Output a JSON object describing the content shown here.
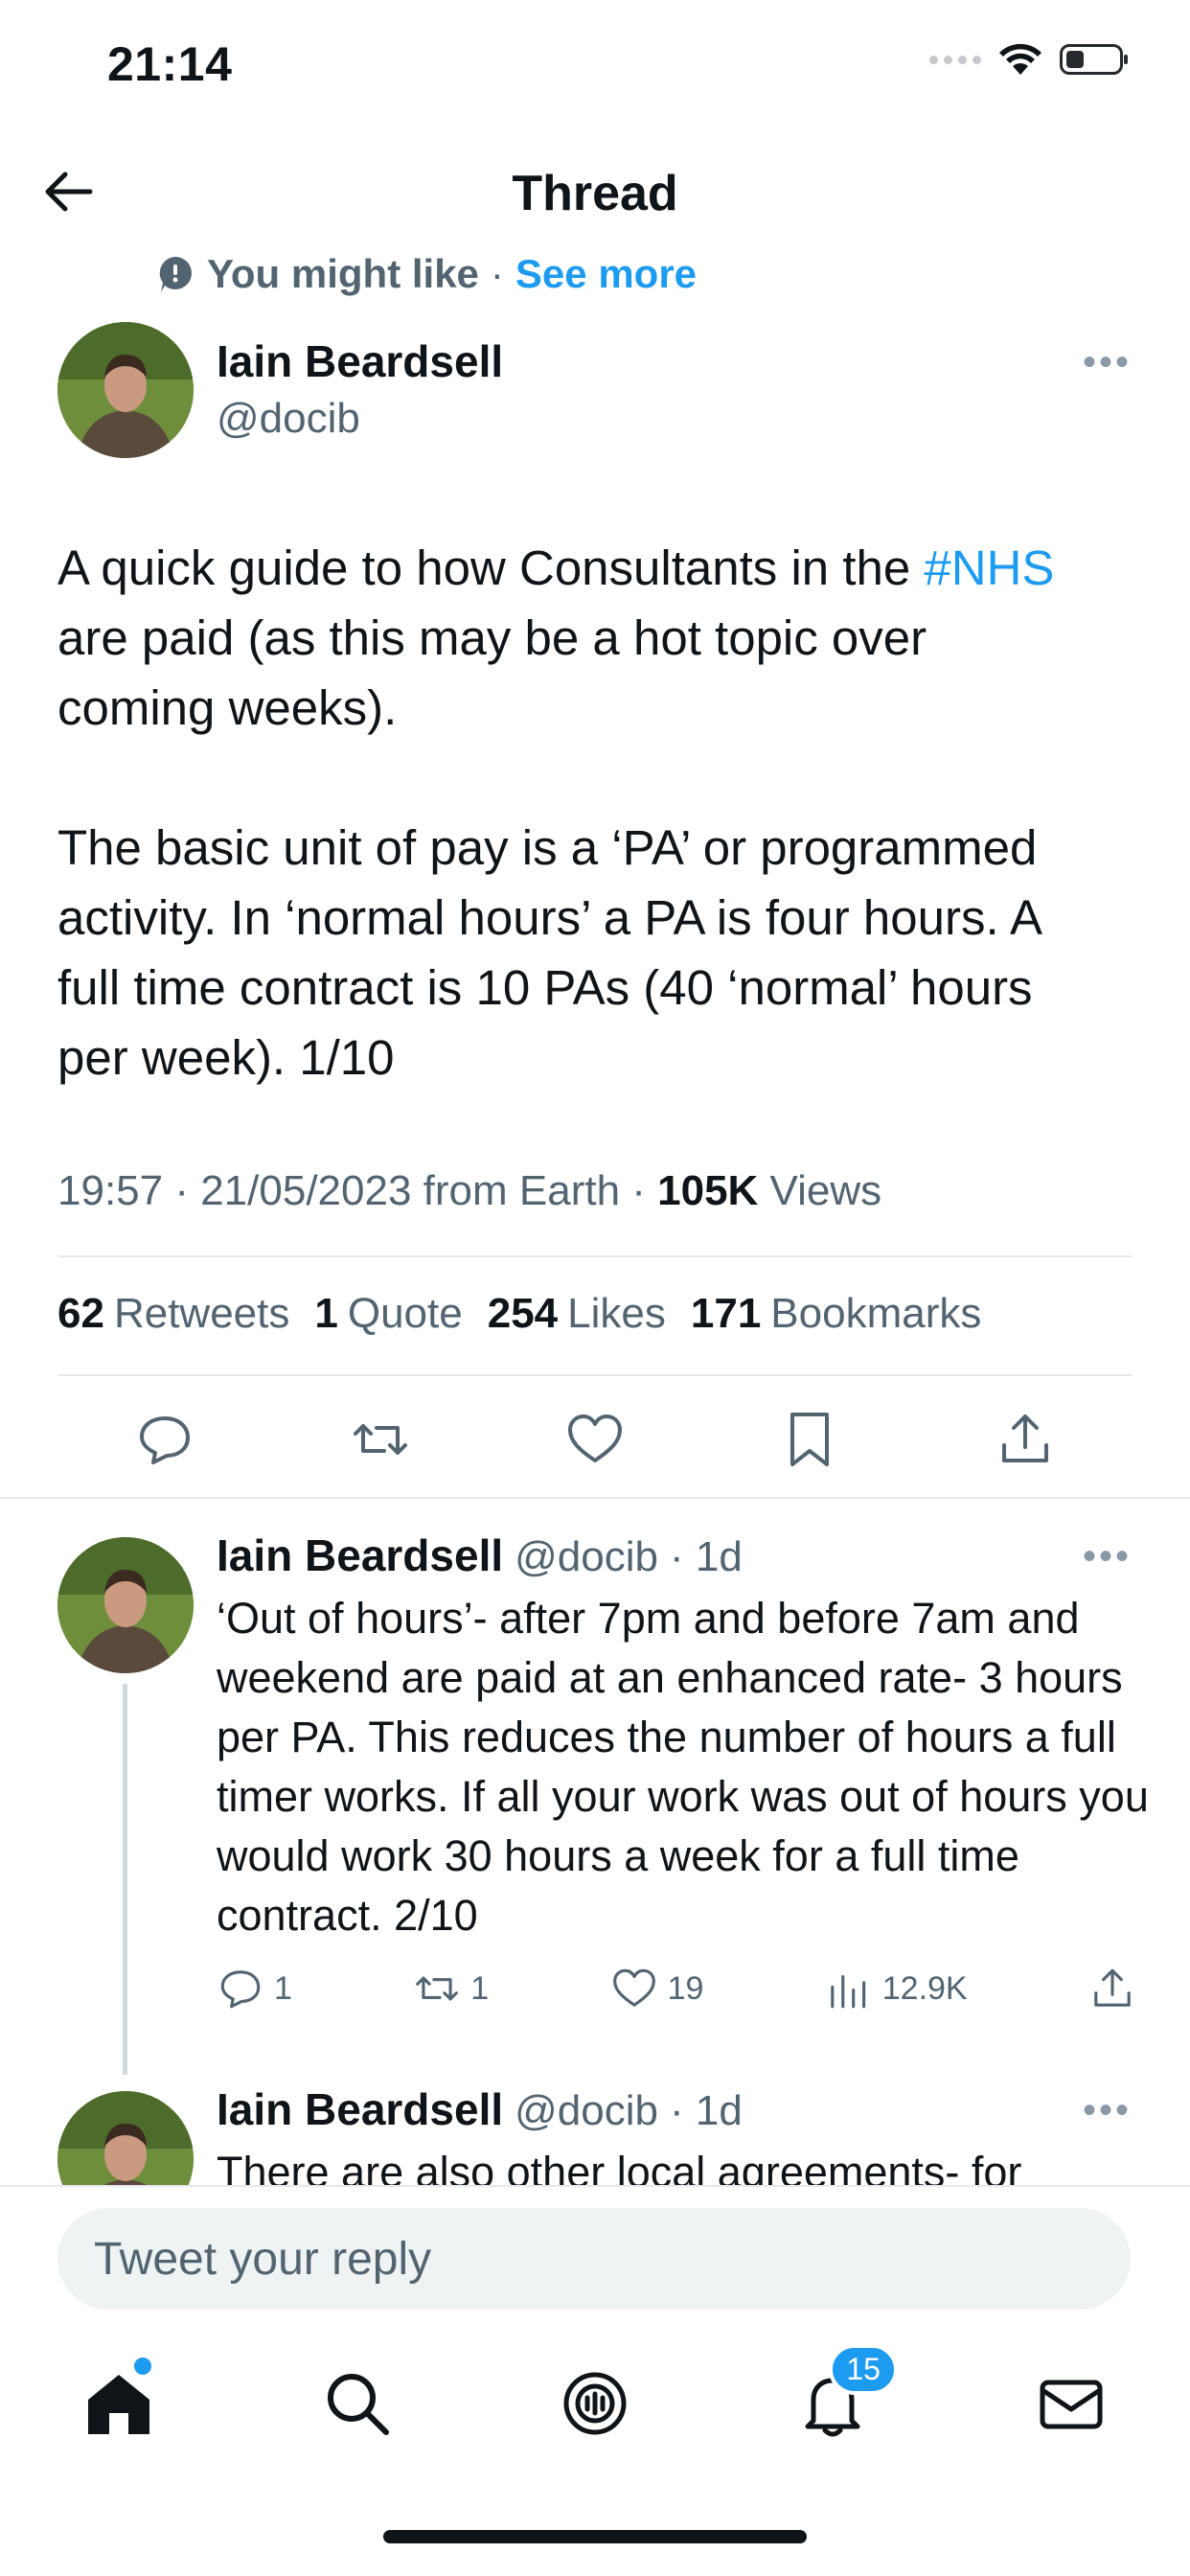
{
  "status_bar": {
    "time": "21:14"
  },
  "header": {
    "title": "Thread"
  },
  "suggestion": {
    "label": "You might like",
    "separator": "·",
    "link": "See more"
  },
  "main_tweet": {
    "name": "Iain Beardsell",
    "handle": "@docib",
    "text_before_tag": "A quick guide to how Consultants in the ",
    "hashtag": "#NHS",
    "text_after_tag": "\nare paid (as this may be a hot topic over\ncoming weeks).\n\nThe basic unit of pay is a ‘PA’ or programmed\nactivity. In ‘normal hours’ a PA is four hours. A\nfull time contract is 10 PAs (40 ‘normal’ hours\nper week). 1/10",
    "timestamp": "19:57 · 21/05/2023 from Earth · ",
    "views_count": "105K",
    "views_label": " Views",
    "stats": {
      "retweets": "62",
      "retweets_label": "Retweets",
      "quotes": "1",
      "quotes_label": "Quote",
      "likes": "254",
      "likes_label": "Likes",
      "bookmarks": "171",
      "bookmarks_label": "Bookmarks"
    }
  },
  "replies": [
    {
      "name": "Iain Beardsell",
      "handle": "@docib",
      "age": "· 1d",
      "text": "‘Out of hours’- after 7pm and before 7am and weekend are paid at an enhanced rate- 3 hours per PA. This reduces the number of hours a full timer works. If all your work was out of hours you would work 30 hours a week for a full time contract. 2/10",
      "replies_count": "1",
      "retweets_count": "1",
      "likes_count": "19",
      "views_count": "12.9K"
    },
    {
      "name": "Iain Beardsell",
      "handle": "@docib",
      "age": "· 1d",
      "text": "There are also other local agreements- for"
    }
  ],
  "compose": {
    "placeholder": "Tweet your reply"
  },
  "tabbar": {
    "notifications_badge": "15"
  },
  "colors": {
    "accent": "#1d9bf0",
    "text": "#0f1419",
    "muted": "#536471"
  }
}
